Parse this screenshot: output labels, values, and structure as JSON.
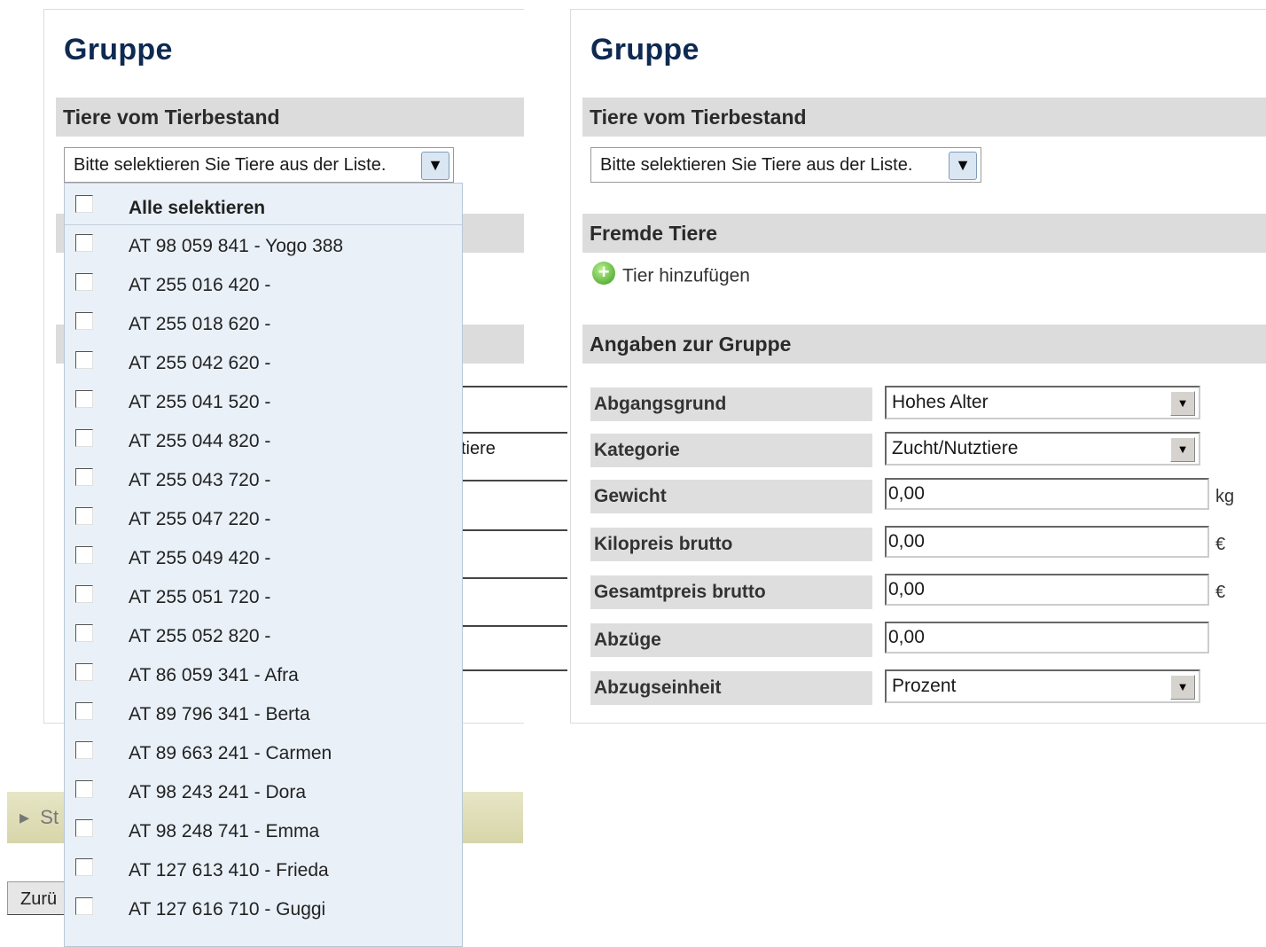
{
  "left_panel": {
    "title": "Gruppe",
    "section_tiere": "Tiere vom Tierbestand",
    "select_placeholder": "Bitte selektieren Sie Tiere aus der Liste.",
    "partial_field_1": "",
    "partial_field_2": "tiere",
    "collapsed_bar_label": "St",
    "back_button": "Zurü"
  },
  "dropdown": {
    "select_all": "Alle selektieren",
    "items": [
      "AT 98 059 841 - Yogo 388",
      "AT 255 016 420 -",
      "AT 255 018 620 -",
      "AT 255 042 620 -",
      "AT 255 041 520 -",
      "AT 255 044 820 -",
      "AT 255 043 720 -",
      "AT 255 047 220 -",
      "AT 255 049 420 -",
      "AT 255 051 720 -",
      "AT 255 052 820 -",
      "AT 86 059 341 - Afra",
      "AT 89 796 341 - Berta",
      "AT 89 663 241 - Carmen",
      "AT 98 243 241 - Dora",
      "AT 98 248 741 - Emma",
      "AT 127 613 410 - Frieda",
      "AT 127 616 710 - Guggi"
    ]
  },
  "right_panel": {
    "title": "Gruppe",
    "section_tiere": "Tiere vom Tierbestand",
    "select_placeholder": "Bitte selektieren Sie Tiere aus der Liste.",
    "section_fremde": "Fremde Tiere",
    "add_link": "Tier hinzufügen",
    "section_angaben": "Angaben zur Gruppe",
    "fields": {
      "abgangsgrund": {
        "label": "Abgangsgrund",
        "value": "Hohes Alter"
      },
      "kategorie": {
        "label": "Kategorie",
        "value": "Zucht/Nutztiere"
      },
      "gewicht": {
        "label": "Gewicht",
        "value": "0,00",
        "unit": "kg"
      },
      "kilopreis": {
        "label": "Kilopreis brutto",
        "value": "0,00",
        "unit": "€"
      },
      "gesamtpreis": {
        "label": "Gesamtpreis brutto",
        "value": "0,00",
        "unit": "€"
      },
      "abzuege": {
        "label": "Abzüge",
        "value": "0,00"
      },
      "abzugseinheit": {
        "label": "Abzugseinheit",
        "value": "Prozent"
      }
    }
  }
}
